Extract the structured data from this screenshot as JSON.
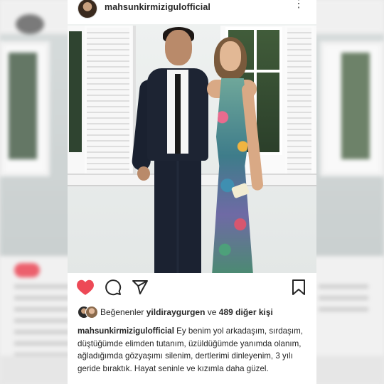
{
  "post": {
    "username": "mahsunkirmizigulofficial",
    "more_icon": "more-vertical-icon",
    "liked_by_label": "Beğenenler",
    "liked_by_user": "yildiraygurgen",
    "and_label": "ve",
    "others_count_text": "489 diğer kişi",
    "caption_username": "mahsunkirmizigulofficial",
    "caption_text": "Ey benim yol arkadaşım, sırdaşım, düştüğümde elimden tutanım, üzüldüğümde yanımda olanım, ağladığımda gözyaşımı silenim, dertlerimi dinleyenim, 3 yılı geride bıraktık. Hayat seninle ve kızımla daha güzel."
  },
  "actions": {
    "like_icon": "heart-filled-icon",
    "like_state": "liked",
    "like_color": "#ed4956",
    "comment_icon": "comment-icon",
    "share_icon": "share-send-icon",
    "save_icon": "bookmark-icon"
  },
  "colors": {
    "text": "#262626",
    "background": "#ffffff"
  }
}
